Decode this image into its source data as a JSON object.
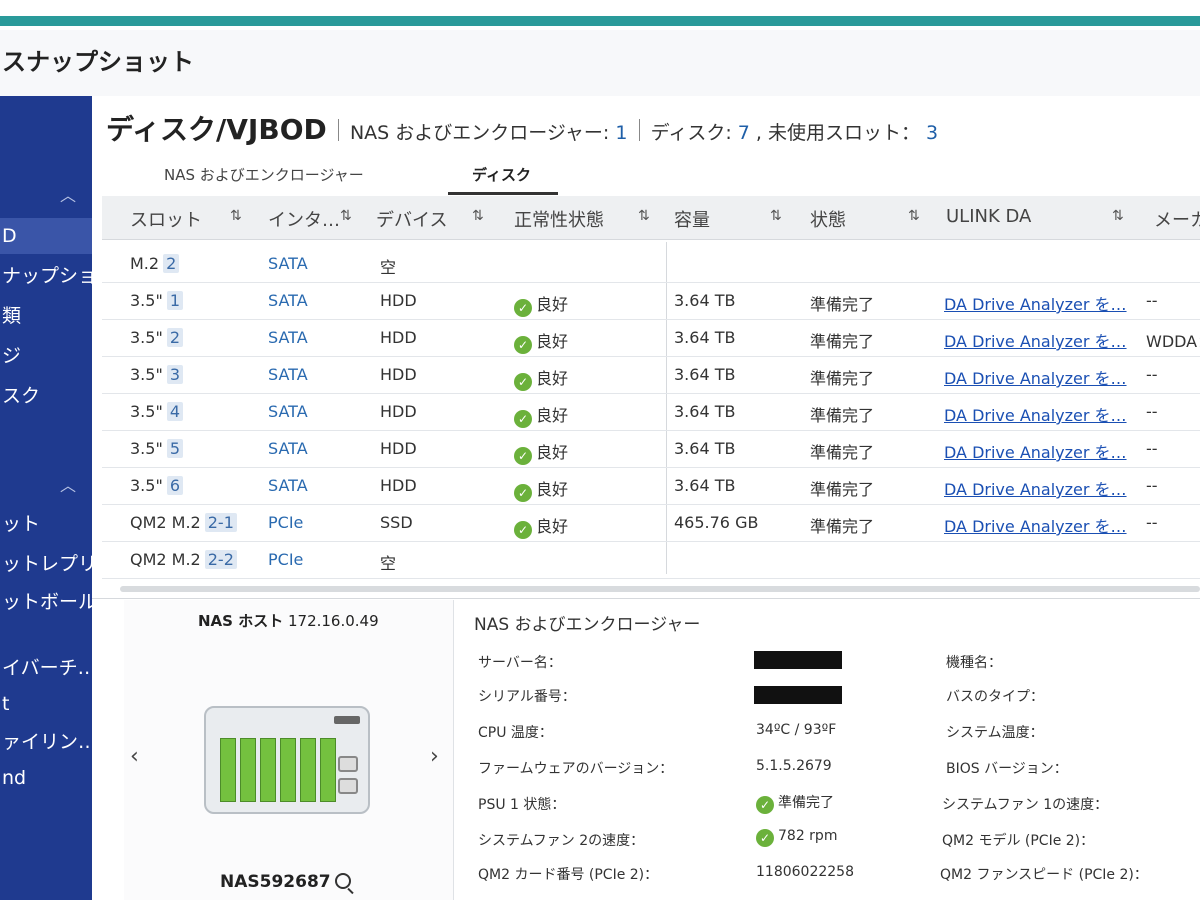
{
  "app_title": "スナップショット",
  "sidebar": {
    "items": [
      {
        "label": "D",
        "active": true
      },
      {
        "label": "ナップショ…"
      },
      {
        "label": "類"
      },
      {
        "label": "ジ"
      },
      {
        "label": "スク"
      },
      {
        "label": "ット"
      },
      {
        "label": "ットレプリカ"
      },
      {
        "label": "ットボールト"
      },
      {
        "label": "イバーチ…"
      },
      {
        "label": "t"
      },
      {
        "label": "ァイリン…"
      },
      {
        "label": "nd"
      }
    ]
  },
  "header": {
    "title": "ディスク/VJBOD",
    "nas_label": "NAS およびエンクロージャー: ",
    "nas_count": "1",
    "disk_label": "ディスク: ",
    "disk_count": "7",
    "slot_label": " , 未使用スロット： ",
    "slot_count": "3"
  },
  "tabs": [
    {
      "label": "NAS およびエンクロージャー"
    },
    {
      "label": "ディスク",
      "active": true
    }
  ],
  "table": {
    "columns": [
      "スロット",
      "インタ…",
      "デバイス",
      "正常性状態",
      "容量",
      "状態",
      "ULINK DA",
      "メーカ"
    ],
    "rows": [
      {
        "slot": "M.2",
        "slot_no": "2",
        "iface": "SATA",
        "device": "空",
        "health": "",
        "capacity": "",
        "status": "",
        "ulink": "",
        "maker": ""
      },
      {
        "slot": "3.5\"",
        "slot_no": "1",
        "iface": "SATA",
        "device": "HDD",
        "health": "良好",
        "capacity": "3.64 TB",
        "status": "準備完了",
        "ulink": "DA Drive Analyzer を…",
        "maker": "--"
      },
      {
        "slot": "3.5\"",
        "slot_no": "2",
        "iface": "SATA",
        "device": "HDD",
        "health": "良好",
        "capacity": "3.64 TB",
        "status": "準備完了",
        "ulink": "DA Drive Analyzer を…",
        "maker": "WDDA："
      },
      {
        "slot": "3.5\"",
        "slot_no": "3",
        "iface": "SATA",
        "device": "HDD",
        "health": "良好",
        "capacity": "3.64 TB",
        "status": "準備完了",
        "ulink": "DA Drive Analyzer を…",
        "maker": "--"
      },
      {
        "slot": "3.5\"",
        "slot_no": "4",
        "iface": "SATA",
        "device": "HDD",
        "health": "良好",
        "capacity": "3.64 TB",
        "status": "準備完了",
        "ulink": "DA Drive Analyzer を…",
        "maker": "--"
      },
      {
        "slot": "3.5\"",
        "slot_no": "5",
        "iface": "SATA",
        "device": "HDD",
        "health": "良好",
        "capacity": "3.64 TB",
        "status": "準備完了",
        "ulink": "DA Drive Analyzer を…",
        "maker": "--"
      },
      {
        "slot": "3.5\"",
        "slot_no": "6",
        "iface": "SATA",
        "device": "HDD",
        "health": "良好",
        "capacity": "3.64 TB",
        "status": "準備完了",
        "ulink": "DA Drive Analyzer を…",
        "maker": "--"
      },
      {
        "slot": "QM2 M.2",
        "slot_no": "2-1",
        "iface": "PCIe",
        "device": "SSD",
        "health": "良好",
        "capacity": "465.76 GB",
        "status": "準備完了",
        "ulink": "DA Drive Analyzer を…",
        "maker": "--"
      },
      {
        "slot": "QM2 M.2",
        "slot_no": "2-2",
        "iface": "PCIe",
        "device": "空",
        "health": "",
        "capacity": "",
        "status": "",
        "ulink": "",
        "maker": ""
      }
    ]
  },
  "host": {
    "label": "NAS ホスト",
    "ip": "172.16.0.49",
    "name": "NAS592687"
  },
  "details": {
    "section_title": "NAS およびエンクロージャー",
    "server_name_label": "サーバー名：",
    "serial_label": "シリアル番号：",
    "cpu_temp_label": "CPU 温度：",
    "cpu_temp_value": "34ºC / 93ºF",
    "firmware_label": "ファームウェアのバージョン：",
    "firmware_value": "5.1.5.2679",
    "psu_label": "PSU 1 状態：",
    "psu_value": "準備完了",
    "fan2_label": "システムファン 2の速度：",
    "fan2_value": "782 rpm",
    "qm2_card_label": "QM2 カード番号 (PCIe 2)：",
    "qm2_card_value": "11806022258",
    "model_label": "機種名：",
    "bus_label": "バスのタイプ：",
    "sys_temp_label": "システム温度：",
    "bios_label": "BIOS バージョン：",
    "fan1_label": "システムファン 1の速度：",
    "qm2_model_label": "QM2 モデル (PCIe 2)：",
    "qm2_fan_label": "QM2 ファンスピード (PCIe 2)："
  },
  "colors": {
    "accent": "#2a9a9a",
    "sidebar": "#1f3a8f",
    "ok": "#6bb13b",
    "link": "#1a4fb3"
  },
  "icons": {
    "ok": "check-circle-icon",
    "sort": "sort-arrows-icon",
    "external": "external-link-icon",
    "zoom": "zoom-in-icon"
  }
}
